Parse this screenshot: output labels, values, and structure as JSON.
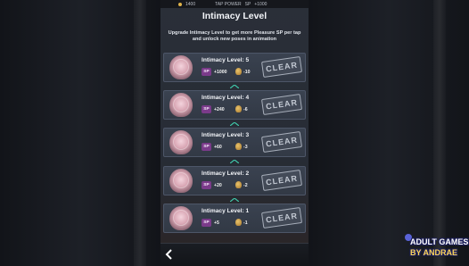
{
  "topbar": {
    "currency": "1400",
    "power_label": "TAP POWER",
    "power_sp": "SP",
    "power_value": "+1000"
  },
  "screen": {
    "title": "Intimacy Level",
    "description": "Upgrade Intimacy Level to get more Pleasure SP per tap and unlock new poses in animation"
  },
  "levels": [
    {
      "label": "Intimacy Level: 5",
      "sp_badge": "SP",
      "sp_value": "+1000",
      "cost": "-10",
      "status": "CLEAR"
    },
    {
      "label": "Intimacy Level: 4",
      "sp_badge": "SP",
      "sp_value": "+240",
      "cost": "-6",
      "status": "CLEAR"
    },
    {
      "label": "Intimacy Level: 3",
      "sp_badge": "SP",
      "sp_value": "+60",
      "cost": "-3",
      "status": "CLEAR"
    },
    {
      "label": "Intimacy Level: 2",
      "sp_badge": "SP",
      "sp_value": "+20",
      "cost": "-2",
      "status": "CLEAR"
    },
    {
      "label": "Intimacy Level: 1",
      "sp_badge": "SP",
      "sp_value": "+5",
      "cost": "-1",
      "status": "CLEAR"
    }
  ],
  "watermark": {
    "line1": "ADULT GAMES",
    "line2": "BY ANDRAE"
  },
  "colors": {
    "accent_sp": "#7b3b8a",
    "chevron": "#3fc6a8",
    "stamp": "#a6adb9"
  },
  "icons": {
    "back": "back-arrow-icon",
    "cost": "potion-icon"
  }
}
